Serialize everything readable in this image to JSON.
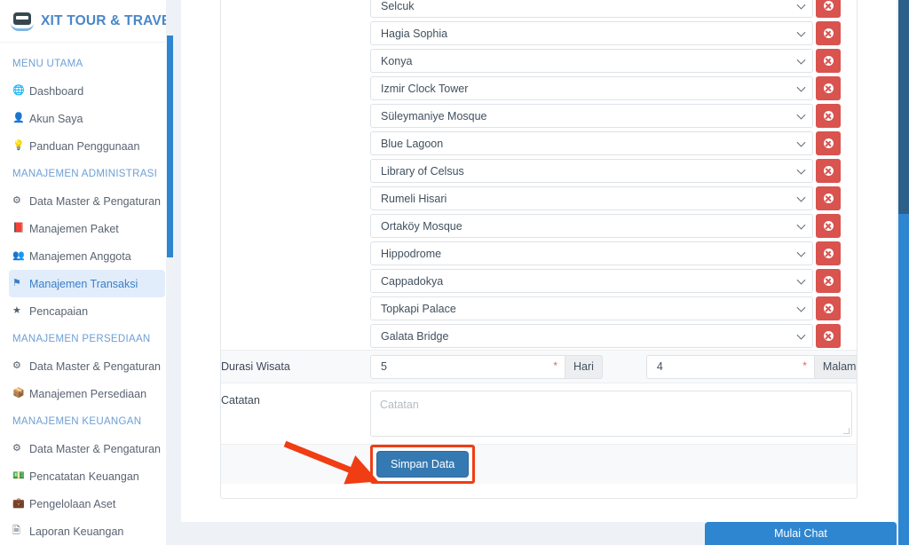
{
  "brand": {
    "name": "XIT TOUR & TRAVEL",
    "logo_icon": "bus-logo-icon"
  },
  "sidebar": {
    "groups": [
      {
        "heading": "MENU UTAMA",
        "items": [
          {
            "label": "Dashboard",
            "icon": "globe-icon",
            "active": false
          },
          {
            "label": "Akun Saya",
            "icon": "user-icon",
            "active": false
          },
          {
            "label": "Panduan Penggunaan",
            "icon": "lightbulb-icon",
            "active": false
          }
        ]
      },
      {
        "heading": "MANAJEMEN ADMINISTRASI",
        "items": [
          {
            "label": "Data Master & Pengaturan",
            "icon": "gears-icon",
            "active": false
          },
          {
            "label": "Manajemen Paket",
            "icon": "book-icon",
            "active": false
          },
          {
            "label": "Manajemen Anggota",
            "icon": "users-icon",
            "active": false
          },
          {
            "label": "Manajemen Transaksi",
            "icon": "flag-icon",
            "active": true
          },
          {
            "label": "Pencapaian",
            "icon": "star-icon",
            "active": false
          }
        ]
      },
      {
        "heading": "MANAJEMEN PERSEDIAAN",
        "items": [
          {
            "label": "Data Master & Pengaturan",
            "icon": "gears-icon",
            "active": false
          },
          {
            "label": "Manajemen Persediaan",
            "icon": "boxes-icon",
            "active": false
          }
        ]
      },
      {
        "heading": "MANAJEMEN KEUANGAN",
        "items": [
          {
            "label": "Data Master & Pengaturan",
            "icon": "gears-icon",
            "active": false
          },
          {
            "label": "Pencatatan Keuangan",
            "icon": "money-icon",
            "active": false
          },
          {
            "label": "Pengelolaan Aset",
            "icon": "briefcase-icon",
            "active": false
          },
          {
            "label": "Laporan Keuangan",
            "icon": "report-icon",
            "active": false
          }
        ]
      }
    ]
  },
  "form": {
    "destinations": [
      {
        "value": "Selcuk"
      },
      {
        "value": "Hagia Sophia"
      },
      {
        "value": "Konya"
      },
      {
        "value": "Izmir Clock Tower"
      },
      {
        "value": "Süleymaniye Mosque"
      },
      {
        "value": "Blue Lagoon"
      },
      {
        "value": "Library of Celsus"
      },
      {
        "value": "Rumeli Hisari"
      },
      {
        "value": "Ortaköy Mosque"
      },
      {
        "value": "Hippodrome"
      },
      {
        "value": "Cappadokya"
      },
      {
        "value": "Topkapi Palace"
      },
      {
        "value": "Galata Bridge"
      }
    ],
    "delete_icon": "remove-circle-icon",
    "duration": {
      "label": "Durasi Wisata",
      "days_value": "5",
      "days_addon": "Hari",
      "nights_value": "4",
      "nights_addon": "Malam",
      "required_marker": "*"
    },
    "note": {
      "label": "Catatan",
      "value": "",
      "placeholder": "Catatan"
    },
    "save_label": "Simpan Data"
  },
  "chat": {
    "label": "Mulai Chat"
  },
  "colors": {
    "brand_blue": "#4a86c8",
    "accent_blue": "#2f86d0",
    "danger_red": "#d9534f",
    "save_blue": "#3579b2",
    "highlight_orange": "#f03d14",
    "active_nav_bg": "#e1edfb",
    "page_bg": "#eef2f7"
  }
}
